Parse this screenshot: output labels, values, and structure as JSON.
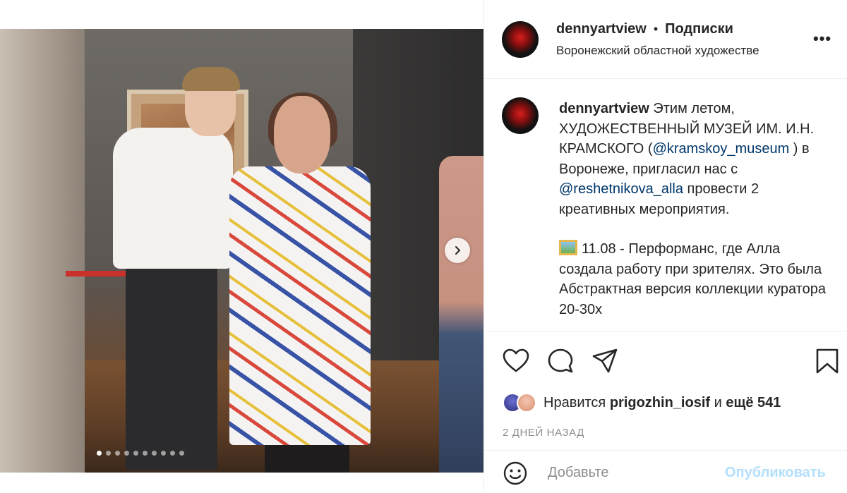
{
  "media": {
    "slides_total": 10,
    "active_slide": 1,
    "next_icon": "chevron-right-icon"
  },
  "header": {
    "username": "dennyartview",
    "separator": "•",
    "follow_label": "Подписки",
    "location": "Воронежский областной художестве",
    "more_label": "•••"
  },
  "caption": {
    "username": "dennyartview",
    "p1_a": " Этим летом, ХУДОЖЕСТВЕННЫЙ МУЗЕЙ ИМ. И.Н. КРАМСКОГО (",
    "mention1": "@kramskoy_museum",
    "p1_b": " ) в Воронеже, пригласил нас с ",
    "mention2": "@reshetnikova_alla",
    "p1_c": " провести 2 креативных мероприятия.",
    "p2": "11.08 - Перформанс, где Алла создала работу при зрителях. Это была Абстрактная версия коллекции куратора 20-30х"
  },
  "actions": {
    "like_icon": "heart-icon",
    "comment_icon": "comment-bubble-icon",
    "share_icon": "paper-plane-icon",
    "save_icon": "bookmark-icon"
  },
  "likes": {
    "prefix": "Нравится ",
    "user": "prigozhin_iosif",
    "middle": " и ",
    "others": "ещё 541"
  },
  "timestamp": "2 ДНЕЙ НАЗАД",
  "comment": {
    "placeholder": "Добавьте",
    "publish_label": "Опубликовать"
  },
  "colors": {
    "mention": "#00376b",
    "publish_disabled": "#b2dffc",
    "muted": "#8e8e8e"
  }
}
